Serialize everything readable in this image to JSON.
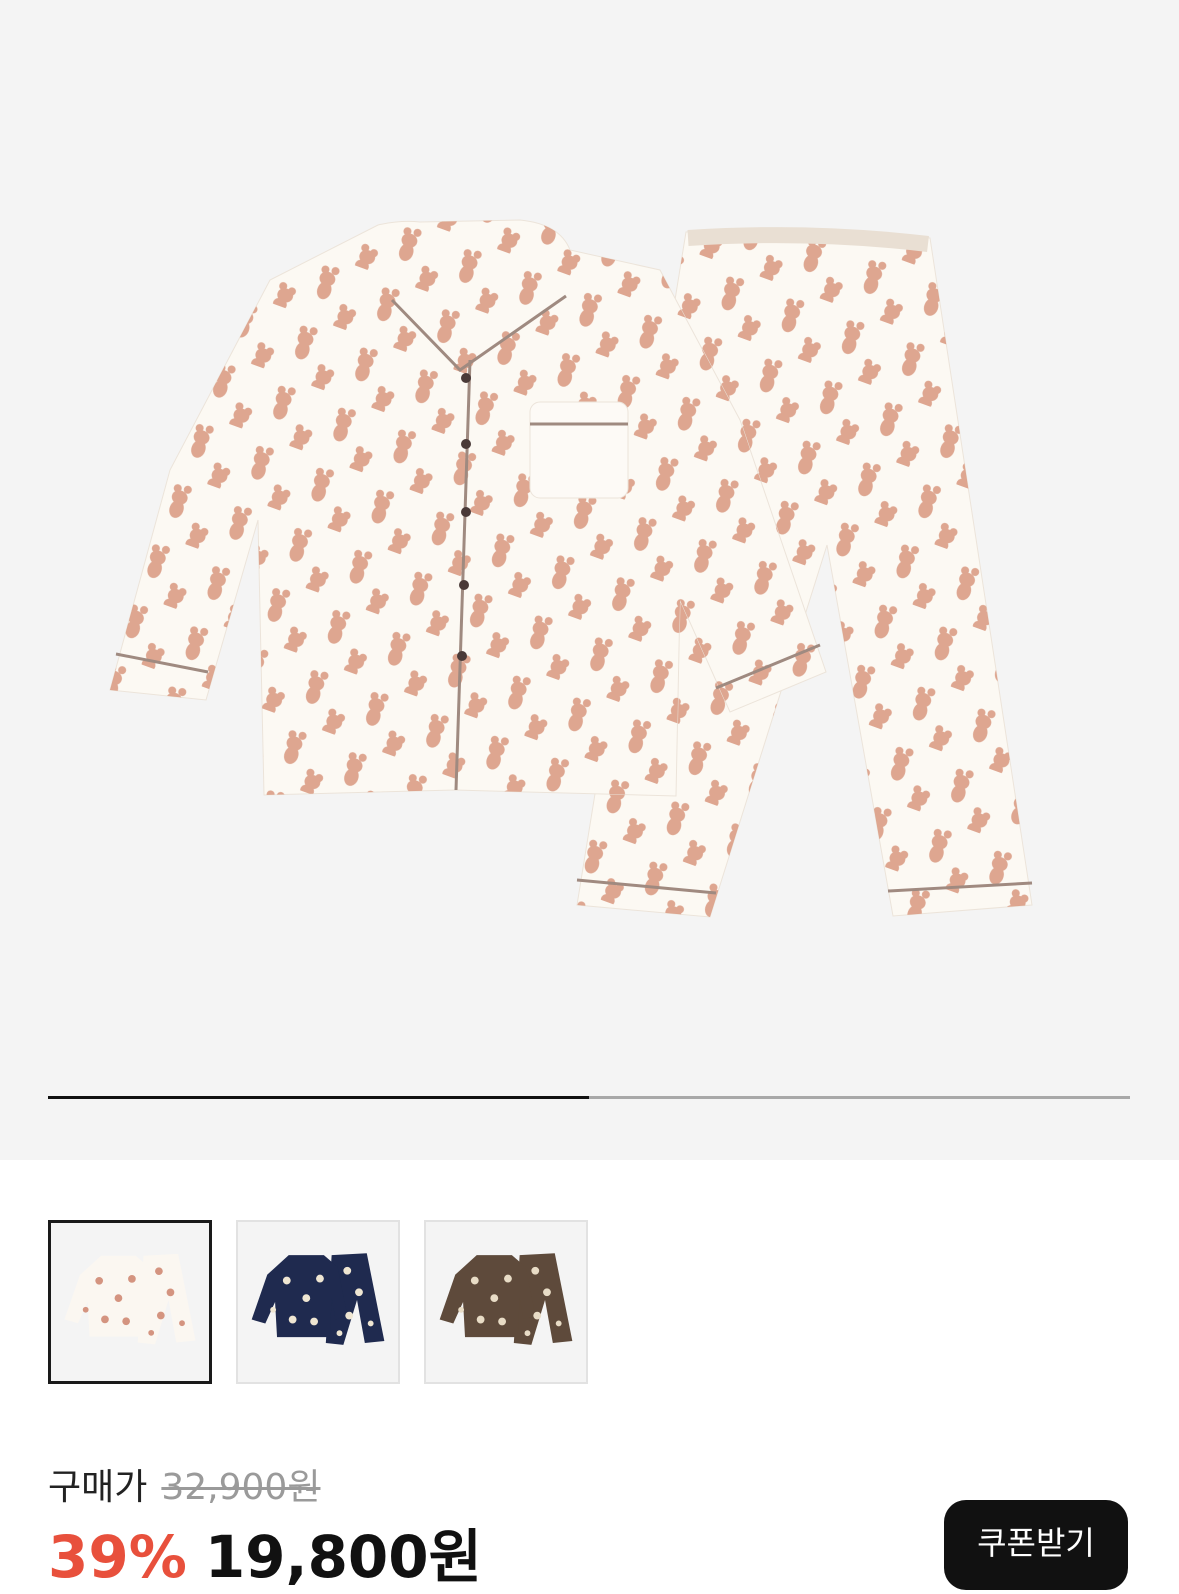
{
  "product_gallery": {
    "current_slide": 1,
    "total_slides": 2,
    "progress_fraction": 0.5,
    "main_image_icon": "pajama-set-image"
  },
  "thumbnails": [
    {
      "color_name": "ivory",
      "shirt_color": "#fbf7f1",
      "print_color": "#d49480",
      "selected": true
    },
    {
      "color_name": "navy",
      "shirt_color": "#1f2a4f",
      "print_color": "#efe6d2",
      "selected": false
    },
    {
      "color_name": "brown",
      "shirt_color": "#5e4a3b",
      "print_color": "#e8dcc6",
      "selected": false
    }
  ],
  "price": {
    "label": "구매가",
    "original": "32,900원",
    "discount": "39%",
    "sale": "19,800원"
  },
  "coupon_button": {
    "label": "쿠폰받기"
  },
  "colors": {
    "discount": "#e8503c",
    "background_gallery": "#f4f4f4",
    "button": "#111111"
  }
}
